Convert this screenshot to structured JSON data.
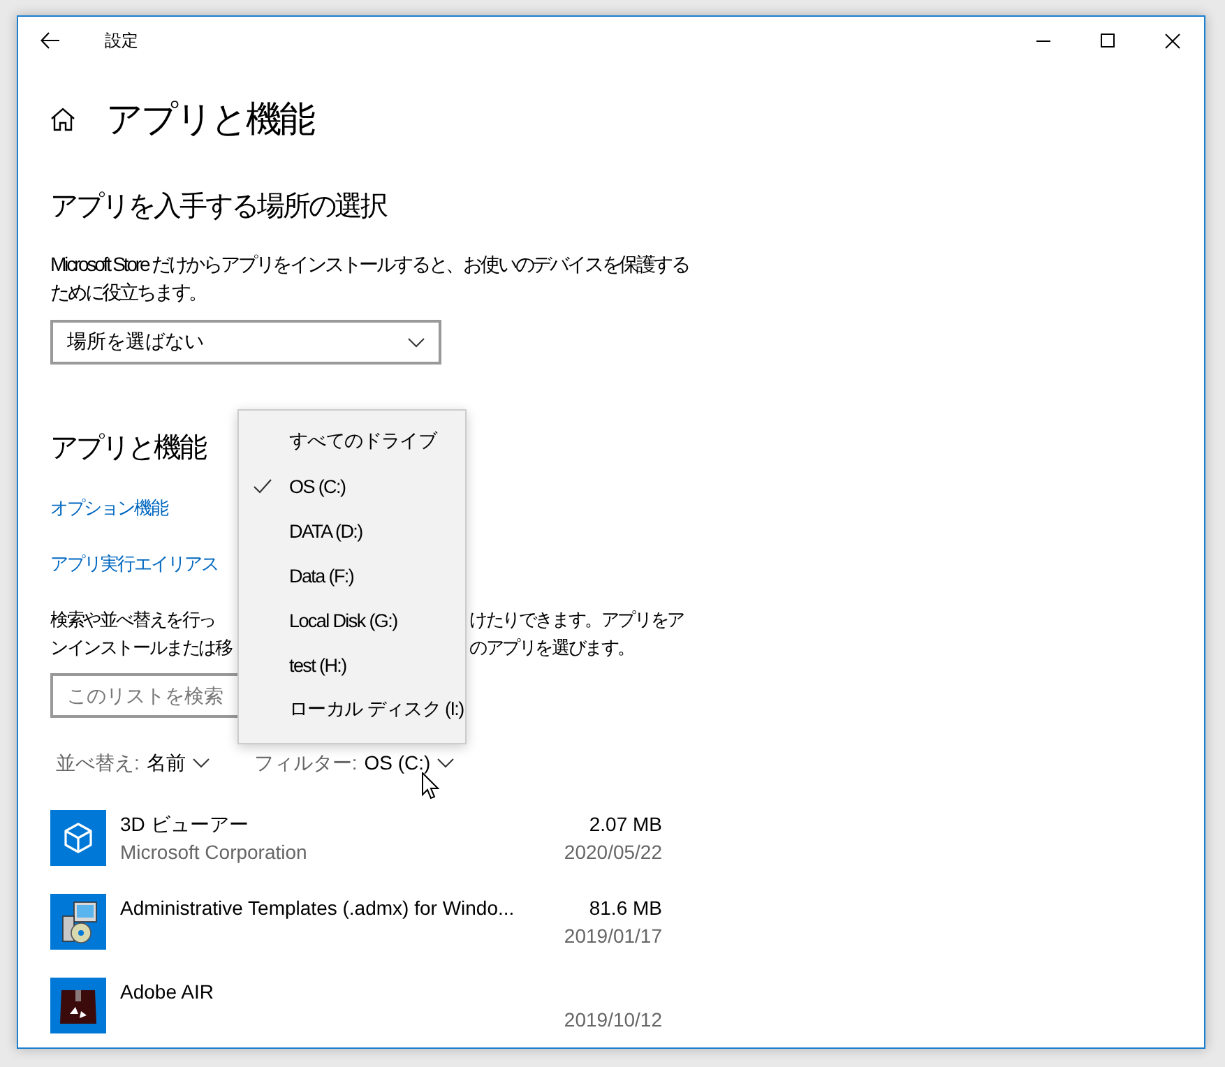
{
  "window": {
    "title": "設定"
  },
  "page_title": "アプリと機能",
  "install_source": {
    "heading": "アプリを入手する場所の選択",
    "description": "Microsoft Store だけからアプリをインストールすると、お使いのデバイスを保護するために役立ちます。",
    "dropdown_value": "場所を選ばない"
  },
  "apps_section": {
    "heading": "アプリと機能",
    "links": [
      "オプション機能",
      "アプリ実行エイリアス"
    ],
    "description_visible": [
      [
        "検索や並べ替えを行っ",
        "けたりできます。アプリをア"
      ],
      [
        "ンインストールまたは移",
        "のアプリを選びます。"
      ]
    ],
    "search": {
      "placeholder": "このリストを検索"
    },
    "sort": {
      "label": "並べ替え:",
      "value": "名前"
    },
    "filter": {
      "label": "フィルター:",
      "value": "OS (C:)"
    }
  },
  "apps": [
    {
      "kind": "cube",
      "name": "3D ビューアー",
      "publisher": "Microsoft Corporation",
      "size": "2.07 MB",
      "date": "2020/05/22"
    },
    {
      "kind": "installer",
      "name": "Administrative Templates (.admx) for Windo...",
      "size": "81.6 MB",
      "date": "2019/01/17"
    },
    {
      "kind": "box",
      "name": "Adobe AIR",
      "date": "2019/10/12"
    }
  ],
  "drive_menu": {
    "items": [
      {
        "label": "すべてのドライブ",
        "selected": false
      },
      {
        "label": "OS (C:)",
        "selected": true
      },
      {
        "label": "DATA (D:)",
        "selected": false
      },
      {
        "label": "Data (F:)",
        "selected": false
      },
      {
        "label": "Local Disk (G:)",
        "selected": false
      },
      {
        "label": "test (H:)",
        "selected": false
      },
      {
        "label": "ローカル ディスク (I:)",
        "selected": false
      }
    ]
  }
}
